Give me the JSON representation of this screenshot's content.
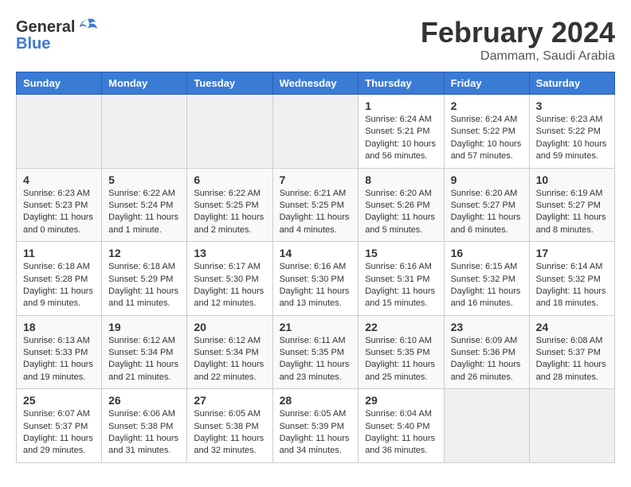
{
  "header": {
    "logo_general": "General",
    "logo_blue": "Blue",
    "title": "February 2024",
    "location": "Dammam, Saudi Arabia"
  },
  "weekdays": [
    "Sunday",
    "Monday",
    "Tuesday",
    "Wednesday",
    "Thursday",
    "Friday",
    "Saturday"
  ],
  "weeks": [
    [
      {
        "day": "",
        "info": ""
      },
      {
        "day": "",
        "info": ""
      },
      {
        "day": "",
        "info": ""
      },
      {
        "day": "",
        "info": ""
      },
      {
        "day": "1",
        "info": "Sunrise: 6:24 AM\nSunset: 5:21 PM\nDaylight: 10 hours\nand 56 minutes."
      },
      {
        "day": "2",
        "info": "Sunrise: 6:24 AM\nSunset: 5:22 PM\nDaylight: 10 hours\nand 57 minutes."
      },
      {
        "day": "3",
        "info": "Sunrise: 6:23 AM\nSunset: 5:22 PM\nDaylight: 10 hours\nand 59 minutes."
      }
    ],
    [
      {
        "day": "4",
        "info": "Sunrise: 6:23 AM\nSunset: 5:23 PM\nDaylight: 11 hours\nand 0 minutes."
      },
      {
        "day": "5",
        "info": "Sunrise: 6:22 AM\nSunset: 5:24 PM\nDaylight: 11 hours\nand 1 minute."
      },
      {
        "day": "6",
        "info": "Sunrise: 6:22 AM\nSunset: 5:25 PM\nDaylight: 11 hours\nand 2 minutes."
      },
      {
        "day": "7",
        "info": "Sunrise: 6:21 AM\nSunset: 5:25 PM\nDaylight: 11 hours\nand 4 minutes."
      },
      {
        "day": "8",
        "info": "Sunrise: 6:20 AM\nSunset: 5:26 PM\nDaylight: 11 hours\nand 5 minutes."
      },
      {
        "day": "9",
        "info": "Sunrise: 6:20 AM\nSunset: 5:27 PM\nDaylight: 11 hours\nand 6 minutes."
      },
      {
        "day": "10",
        "info": "Sunrise: 6:19 AM\nSunset: 5:27 PM\nDaylight: 11 hours\nand 8 minutes."
      }
    ],
    [
      {
        "day": "11",
        "info": "Sunrise: 6:18 AM\nSunset: 5:28 PM\nDaylight: 11 hours\nand 9 minutes."
      },
      {
        "day": "12",
        "info": "Sunrise: 6:18 AM\nSunset: 5:29 PM\nDaylight: 11 hours\nand 11 minutes."
      },
      {
        "day": "13",
        "info": "Sunrise: 6:17 AM\nSunset: 5:30 PM\nDaylight: 11 hours\nand 12 minutes."
      },
      {
        "day": "14",
        "info": "Sunrise: 6:16 AM\nSunset: 5:30 PM\nDaylight: 11 hours\nand 13 minutes."
      },
      {
        "day": "15",
        "info": "Sunrise: 6:16 AM\nSunset: 5:31 PM\nDaylight: 11 hours\nand 15 minutes."
      },
      {
        "day": "16",
        "info": "Sunrise: 6:15 AM\nSunset: 5:32 PM\nDaylight: 11 hours\nand 16 minutes."
      },
      {
        "day": "17",
        "info": "Sunrise: 6:14 AM\nSunset: 5:32 PM\nDaylight: 11 hours\nand 18 minutes."
      }
    ],
    [
      {
        "day": "18",
        "info": "Sunrise: 6:13 AM\nSunset: 5:33 PM\nDaylight: 11 hours\nand 19 minutes."
      },
      {
        "day": "19",
        "info": "Sunrise: 6:12 AM\nSunset: 5:34 PM\nDaylight: 11 hours\nand 21 minutes."
      },
      {
        "day": "20",
        "info": "Sunrise: 6:12 AM\nSunset: 5:34 PM\nDaylight: 11 hours\nand 22 minutes."
      },
      {
        "day": "21",
        "info": "Sunrise: 6:11 AM\nSunset: 5:35 PM\nDaylight: 11 hours\nand 23 minutes."
      },
      {
        "day": "22",
        "info": "Sunrise: 6:10 AM\nSunset: 5:35 PM\nDaylight: 11 hours\nand 25 minutes."
      },
      {
        "day": "23",
        "info": "Sunrise: 6:09 AM\nSunset: 5:36 PM\nDaylight: 11 hours\nand 26 minutes."
      },
      {
        "day": "24",
        "info": "Sunrise: 6:08 AM\nSunset: 5:37 PM\nDaylight: 11 hours\nand 28 minutes."
      }
    ],
    [
      {
        "day": "25",
        "info": "Sunrise: 6:07 AM\nSunset: 5:37 PM\nDaylight: 11 hours\nand 29 minutes."
      },
      {
        "day": "26",
        "info": "Sunrise: 6:06 AM\nSunset: 5:38 PM\nDaylight: 11 hours\nand 31 minutes."
      },
      {
        "day": "27",
        "info": "Sunrise: 6:05 AM\nSunset: 5:38 PM\nDaylight: 11 hours\nand 32 minutes."
      },
      {
        "day": "28",
        "info": "Sunrise: 6:05 AM\nSunset: 5:39 PM\nDaylight: 11 hours\nand 34 minutes."
      },
      {
        "day": "29",
        "info": "Sunrise: 6:04 AM\nSunset: 5:40 PM\nDaylight: 11 hours\nand 36 minutes."
      },
      {
        "day": "",
        "info": ""
      },
      {
        "day": "",
        "info": ""
      }
    ]
  ]
}
